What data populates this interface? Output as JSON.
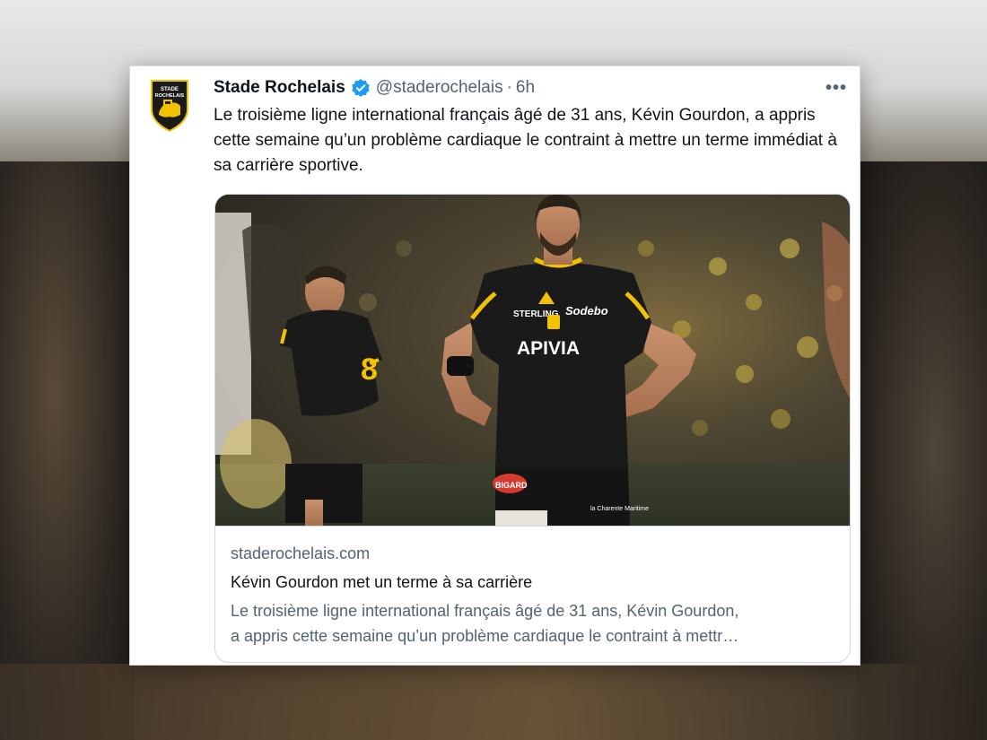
{
  "tweet": {
    "display_name": "Stade Rochelais",
    "handle": "@staderochelais",
    "separator": "·",
    "time": "6h",
    "more_label": "•••",
    "text": "Le troisième ligne international français âgé de 31 ans, Kévin Gourdon, a appris cette semaine qu’un problème cardiaque le contraint à mettre un terme immédiat à sa carrière sportive.",
    "avatar": {
      "logo_line1": "STADE",
      "logo_line2": "ROCHELAIS",
      "icon": "club-crest-icon"
    },
    "verified_icon": "verified-badge-icon"
  },
  "link_card": {
    "domain": "staderochelais.com",
    "title": "Kévin Gourdon met un terme à sa carrière",
    "description_line1": "Le troisième ligne international français âgé de 31 ans, Kévin Gourdon,",
    "description_line2": "a appris cette semaine qu’un problème cardiaque le contraint à mettr…",
    "photo": {
      "sponsor_main": "APIVIA",
      "sponsor_chest_left": "STERLING",
      "sponsor_chest_right": "Sodebo",
      "sponsor_shorts": "BIGARD",
      "shorts_text": "la Charente Maritime",
      "jersey_number": "8"
    }
  },
  "colors": {
    "accent_yellow": "#f2c200",
    "verified_blue": "#1d9bf0",
    "jersey_black": "#1a1a1a"
  }
}
